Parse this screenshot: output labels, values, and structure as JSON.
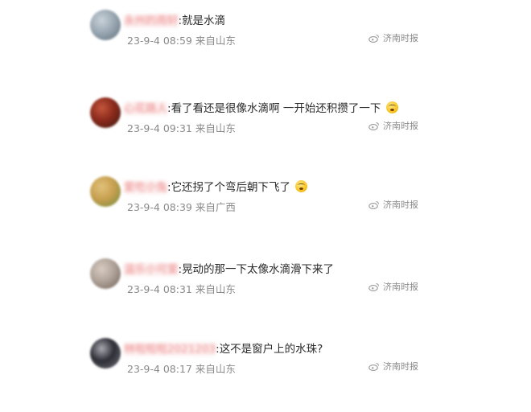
{
  "comments": [
    {
      "nickname": "永州的雨轩",
      "text": "就是水滴",
      "emoji": false,
      "date": "23-9-4",
      "time": "08:59",
      "location": "来自山东",
      "source": "济南时报",
      "avatar_colors": [
        "#9aa8b4",
        "#5e6e78",
        "#c9d2d8"
      ]
    },
    {
      "nickname": "心花路人",
      "text": "看了看还是很像水滴啊 一开始还积攒了一下",
      "emoji": true,
      "date": "23-9-4",
      "time": "09:31",
      "location": "来自山东",
      "source": "济南时报",
      "avatar_colors": [
        "#8b2a1c",
        "#3a1a12",
        "#c4563c"
      ]
    },
    {
      "nickname": "爱吃小兔",
      "text": "它还拐了个弯后朝下飞了",
      "emoji": true,
      "date": "23-9-4",
      "time": "08:39",
      "location": "来自广西",
      "source": "济南时报",
      "avatar_colors": [
        "#c8a050",
        "#6b8a3a",
        "#e0c27a"
      ]
    },
    {
      "nickname": "温乐小可爱",
      "text": "晃动的那一下太像水滴滑下来了",
      "emoji": false,
      "date": "23-9-4",
      "time": "08:31",
      "location": "来自山东",
      "source": "济南时报",
      "avatar_colors": [
        "#b0a49a",
        "#6e5e54",
        "#d8ccc2"
      ]
    },
    {
      "nickname": "林啦啦啦2021203",
      "text": "这不是窗户上的水珠?",
      "emoji": false,
      "date": "23-9-4",
      "time": "08:17",
      "location": "来自山东",
      "source": "济南时报",
      "avatar_colors": [
        "#2e2e36",
        "#6e7078",
        "#a8aab0"
      ]
    }
  ]
}
